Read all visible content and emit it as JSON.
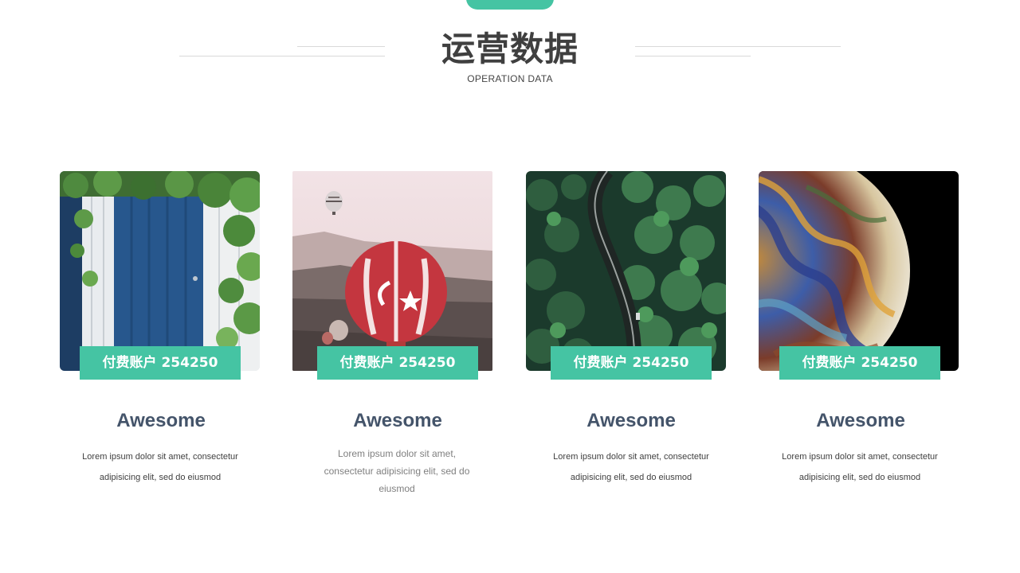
{
  "header": {
    "title": "运营数据",
    "subtitle": "OPERATION DATA"
  },
  "colors": {
    "accent": "#45c4a3",
    "title": "#3f3f3f",
    "card_title": "#44546a"
  },
  "cards": [
    {
      "image": "blue-door-with-ivy",
      "badge": "付费账户 254250",
      "title": "Awesome",
      "description": "Lorem ipsum dolor sit amet, consectetur adipisicing elit, sed do eiusmod"
    },
    {
      "image": "hot-air-balloons",
      "badge": "付费账户 254250",
      "title": "Awesome",
      "description": "Lorem ipsum dolor sit amet, consectetur adipisicing elit, sed do eiusmod"
    },
    {
      "image": "forest-road-aerial",
      "badge": "付费账户 254250",
      "title": "Awesome",
      "description": "Lorem ipsum dolor sit amet, consectetur adipisicing elit, sed do eiusmod"
    },
    {
      "image": "marbled-planet",
      "badge": "付费账户 254250",
      "title": "Awesome",
      "description": "Lorem ipsum dolor sit amet, consectetur adipisicing elit, sed do eiusmod"
    }
  ]
}
